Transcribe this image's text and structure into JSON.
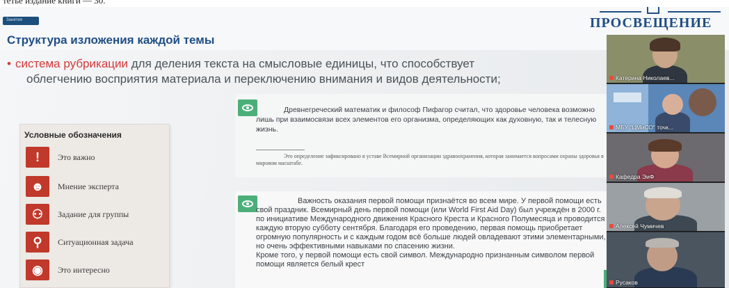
{
  "top_strip": {
    "text": "тетье издание книги — 30."
  },
  "slide": {
    "tag": "Занятия",
    "title": "Структура изложения каждой темы",
    "logo": "ПРОСВЕЩЕНИЕ",
    "bullet": {
      "accent": "система рубрикации",
      "rest": " для деления текста на смысловые единицы, что способствует",
      "line2": "облегчению восприятия материала и переключению внимания и видов деятельности;"
    },
    "legend": {
      "title": "Условные обозначения",
      "items": [
        {
          "label": "Это важно",
          "icon": "exclamation-icon",
          "glyph": "!"
        },
        {
          "label": "Мнение эксперта",
          "icon": "expert-icon",
          "glyph": "☻"
        },
        {
          "label": "Задание для группы",
          "icon": "group-task-icon",
          "glyph": "⚇"
        },
        {
          "label": "Ситуационная задача",
          "icon": "magnifier-icon",
          "glyph": "⚲"
        },
        {
          "label": "Это интересно",
          "icon": "eye-icon",
          "glyph": "◉"
        }
      ]
    },
    "card1": {
      "text": "Древнегреческий математик и философ Пифагор считал, что здоровье человека возможно лишь при взаимосвязи всех элементов его организма, определяющих как духовную, так и телесную жизнь.",
      "footnote": "Это определение зафиксировано в уставе Всемирной организации здравоохранения, которая занимается вопросами охраны здоровья в мировом масштабе."
    },
    "card2": {
      "text": "Важность оказания первой помощи признаётся во всем мире. У первой помощи есть свой праздник. Всемирный день первой помощи (или World First Aid Day) был учреждён в 2000 г. по инициативе Международного движения Красного Креста и Красного Полумесяца и проводится каждую вторую субботу сентября. Благодаря его проведению, первая помощь приобретает огромную популярность и с каждым годом всё больше людей овладевают этими элементарными, но очень эффективными навыками по спасению жизни.",
      "text2": "Кроме того, у первой помощи есть свой символ. Международно признанным символом первой помощи является белый крест"
    }
  },
  "video": {
    "participants": [
      {
        "name": "Катерина Николаев..."
      },
      {
        "name": "МБУ \"ЦМиСО\" точк..."
      },
      {
        "name": "Кафедра ЭиФ"
      },
      {
        "name": "Алексей Чумичев"
      },
      {
        "name": "Русаков"
      }
    ]
  },
  "colors": {
    "brand": "#1f4e85",
    "accent_red": "#d53a3a",
    "icon_green": "#4caf7a",
    "legend_red": "#c0392b"
  }
}
